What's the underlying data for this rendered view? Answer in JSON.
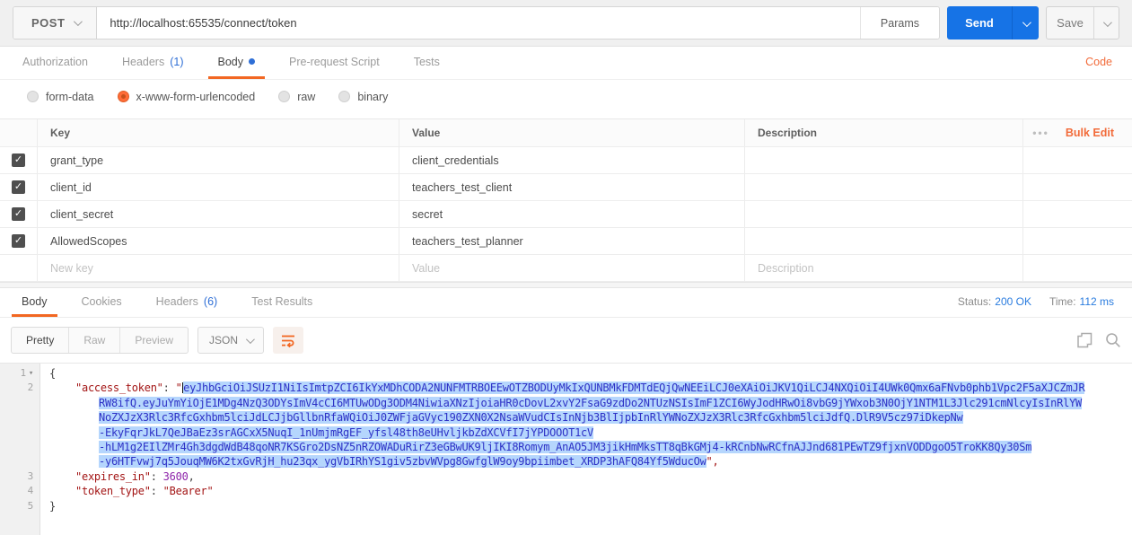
{
  "colors": {
    "accent_orange": "#f26722",
    "accent_blue": "#2f6fd6",
    "send_blue": "#1673e6",
    "selection_blue": "#b5d6fd",
    "token_text_blue": "#2d31c6"
  },
  "request_bar": {
    "method": "POST",
    "url": "http://localhost:65535/connect/token",
    "params_label": "Params",
    "send_label": "Send",
    "save_label": "Save"
  },
  "request_tabs": {
    "tabs": [
      {
        "label": "Authorization"
      },
      {
        "label": "Headers",
        "count": "(1)"
      },
      {
        "label": "Body",
        "active": true,
        "has_dot": true
      },
      {
        "label": "Pre-request Script"
      },
      {
        "label": "Tests"
      }
    ],
    "code_link": "Code"
  },
  "body_types": {
    "options": [
      {
        "label": "form-data",
        "selected": false
      },
      {
        "label": "x-www-form-urlencoded",
        "selected": true
      },
      {
        "label": "raw",
        "selected": false
      },
      {
        "label": "binary",
        "selected": false
      }
    ]
  },
  "kv_table": {
    "headers": {
      "key": "Key",
      "value": "Value",
      "description": "Description"
    },
    "menu_dots": "•••",
    "bulk_edit_label": "Bulk Edit",
    "check_glyph": "✓",
    "rows": [
      {
        "key": "grant_type",
        "value": "client_credentials",
        "checked": true
      },
      {
        "key": "client_id",
        "value": "teachers_test_client",
        "checked": true
      },
      {
        "key": "client_secret",
        "value": "secret",
        "checked": true
      },
      {
        "key": "AllowedScopes",
        "value": "teachers_test_planner",
        "checked": true
      }
    ],
    "new_row": {
      "key_placeholder": "New key",
      "value_placeholder": "Value",
      "description_placeholder": "Description"
    }
  },
  "response_tabs": {
    "tabs": [
      {
        "label": "Body",
        "active": true
      },
      {
        "label": "Cookies"
      },
      {
        "label": "Headers",
        "count": "(6)"
      },
      {
        "label": "Test Results"
      }
    ],
    "status_label": "Status:",
    "status_value": "200 OK",
    "time_label": "Time:",
    "time_value": "112 ms"
  },
  "response_toolbar": {
    "views": [
      "Pretty",
      "Raw",
      "Preview"
    ],
    "active_view": "Pretty",
    "language": "JSON"
  },
  "editor": {
    "fold_icon": "▾",
    "line_numbers": [
      "1",
      "2",
      "3",
      "4",
      "5"
    ],
    "punctuation": {
      "open_brace": "{",
      "close_brace": "}",
      "colon": ": ",
      "comma": ",",
      "open_quote": "\"",
      "close_quote_comma": "\","
    },
    "keys": {
      "access_token": "\"access_token\"",
      "expires_in": "\"expires_in\"",
      "token_type": "\"token_type\""
    },
    "values": {
      "expires_in": "3600",
      "token_type": "\"Bearer\""
    },
    "token_lines": [
      "eyJhbGciOiJSUzI1NiIsImtpZCI6IkYxMDhCODA2NUNFMTRBOEEwOTZBODUyMkIxQUNBMkFDMTdEQjQwNEEiLCJ0eXAiOiJKV1QiLCJ4NXQiOiI4UWk0Qmx6aFNvb0phb1Vpc2F5aXJCZmJR",
      "RW8ifQ.eyJuYmYiOjE1MDg4NzQ3ODYsImV4cCI6MTUwODg3ODM4NiwiaXNzIjoiaHR0cDovL2xvY2FsaG9zdDo2NTUzNSIsImF1ZCI6WyJodHRwOi8vbG9jYWxob3N0OjY1NTM1L3Jlc291cmNlcyIsInRlYW",
      "NoZXJzX3Rlc3RfcGxhbm5lciJdLCJjbGllbnRfaWQiOiJ0ZWFjaGVyc190ZXN0X2NsaWVudCIsInNjb3BlIjpbInRlYWNoZXJzX3Rlc3RfcGxhbm5lciJdfQ.DlR9V5cz97iDkepNw",
      "-EkyFqrJkL7QeJBaEz3srAGCxX5NuqI_1nUmjmRgEF_yfsl48th8eUHvljkbZdXCVfI7jYPDOOOT1cV",
      "-hLM1g2EIlZMr4Gh3dgdWdB48qoNR7KSGro2DsNZ5nRZOWADuRirZ3eGBwUK9ljIKI8Romym_AnAO5JM3jikHmMksTT8qBkGMj4-kRCnbNwRCfnAJJnd681PEwTZ9fjxnVODDgoO5TroKK8Qy30Sm",
      "-y6HTFvwj7q5JouqMW6K2txGvRjH_hu23qx_ygVbIRhYS1giv5zbvWVpg8GwfglW9oy9bpiimbet_XRDP3hAFQ84Yf5WducOw"
    ]
  }
}
